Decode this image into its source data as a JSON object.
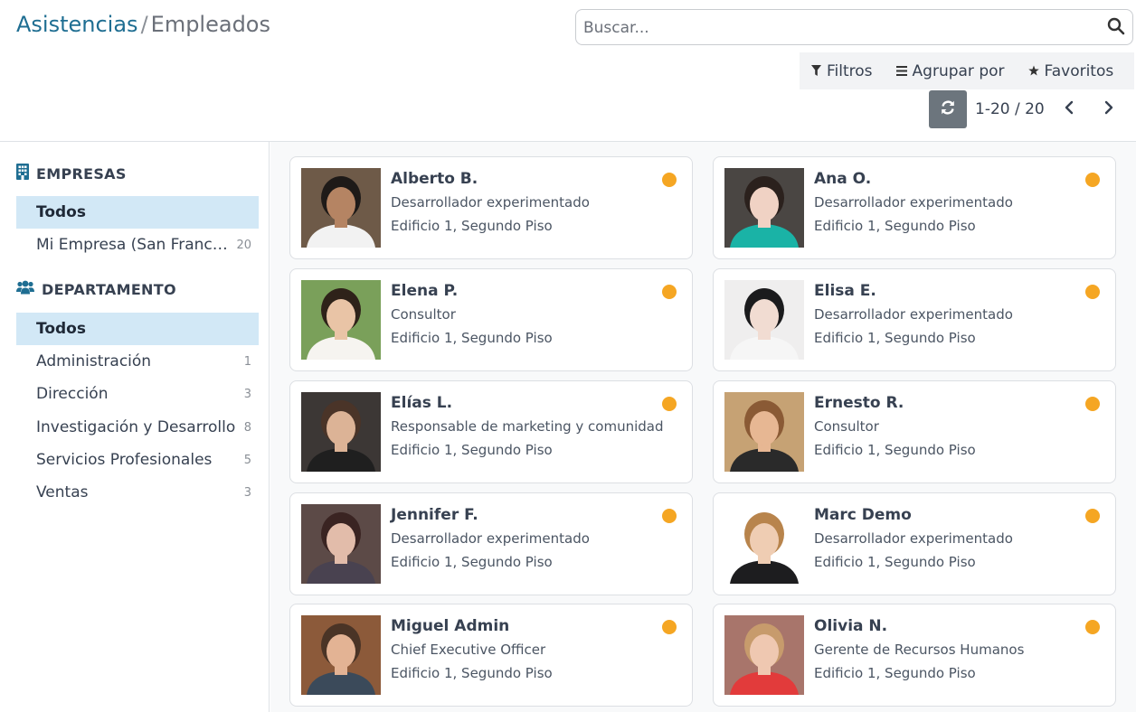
{
  "breadcrumb": {
    "parent": "Asistencias",
    "separator": "/",
    "current": "Empleados"
  },
  "search": {
    "placeholder": "Buscar...",
    "value": ""
  },
  "filters": {
    "filtros": "Filtros",
    "agrupar": "Agrupar por",
    "favoritos": "Favoritos"
  },
  "pager": {
    "value": "1-20 / 20"
  },
  "sidebar": {
    "empresas": {
      "title": "EMPRESAS",
      "items": [
        {
          "label": "Todos",
          "count": "",
          "active": true
        },
        {
          "label": "Mi Empresa (San Francisco)",
          "count": "20",
          "active": false
        }
      ]
    },
    "departamento": {
      "title": "DEPARTAMENTO",
      "items": [
        {
          "label": "Todos",
          "count": "",
          "active": true
        },
        {
          "label": "Administración",
          "count": "1",
          "active": false
        },
        {
          "label": "Dirección",
          "count": "3",
          "active": false
        },
        {
          "label": "Investigación y Desarrollo",
          "count": "8",
          "active": false
        },
        {
          "label": "Servicios Profesionales",
          "count": "5",
          "active": false
        },
        {
          "label": "Ventas",
          "count": "3",
          "active": false
        }
      ]
    }
  },
  "employees": [
    {
      "name": "Alberto B.",
      "job": "Desarrollador experimentado",
      "location": "Edificio 1, Segundo Piso",
      "status_color": "#f5a623",
      "avatar": {
        "bg": "#6e5a48",
        "skin": "#b58463",
        "hair": "#1e1a18",
        "shirt": "#f2f2f2"
      }
    },
    {
      "name": "Ana O.",
      "job": "Desarrollador experimentado",
      "location": "Edificio 1, Segundo Piso",
      "status_color": "#f5a623",
      "avatar": {
        "bg": "#4a4643",
        "skin": "#f0d2c4",
        "hair": "#2b211d",
        "shirt": "#1ab3a6"
      }
    },
    {
      "name": "Elena P.",
      "job": "Consultor",
      "location": "Edificio 1, Segundo Piso",
      "status_color": "#f5a623",
      "avatar": {
        "bg": "#7aa05a",
        "skin": "#e9c4a6",
        "hair": "#2e2219",
        "shirt": "#f6f4f0"
      }
    },
    {
      "name": "Elisa E.",
      "job": "Desarrollador experimentado",
      "location": "Edificio 1, Segundo Piso",
      "status_color": "#f5a623",
      "avatar": {
        "bg": "#efeeee",
        "skin": "#f1dcd2",
        "hair": "#1b1b1d",
        "shirt": "#f6f6f6"
      }
    },
    {
      "name": "Elías L.",
      "job": "Responsable de marketing y comunidad",
      "location": "Edificio 1, Segundo Piso",
      "status_color": "#f5a623",
      "avatar": {
        "bg": "#3c3735",
        "skin": "#dcb396",
        "hair": "#4a3428",
        "shirt": "#1f1f1f"
      }
    },
    {
      "name": "Ernesto R.",
      "job": "Consultor",
      "location": "Edificio 1, Segundo Piso",
      "status_color": "#f5a623",
      "avatar": {
        "bg": "#c6a274",
        "skin": "#e7b793",
        "hair": "#8a5a35",
        "shirt": "#2a2a2a"
      }
    },
    {
      "name": "Jennifer F.",
      "job": "Desarrollador experimentado",
      "location": "Edificio 1, Segundo Piso",
      "status_color": "#f5a623",
      "avatar": {
        "bg": "#5c4a47",
        "skin": "#e2bcaa",
        "hair": "#3a2422",
        "shirt": "#494250"
      }
    },
    {
      "name": "Marc Demo",
      "job": "Desarrollador experimentado",
      "location": "Edificio 1, Segundo Piso",
      "status_color": "#f5a623",
      "avatar": {
        "bg": "#ffffff",
        "skin": "#efcdb3",
        "hair": "#b8844c",
        "shirt": "#1d1d1f"
      }
    },
    {
      "name": "Miguel Admin",
      "job": "Chief Executive Officer",
      "location": "Edificio 1, Segundo Piso",
      "status_color": "#f5a623",
      "avatar": {
        "bg": "#8c5a3a",
        "skin": "#e3b394",
        "hair": "#4a3426",
        "shirt": "#3b4a5a"
      }
    },
    {
      "name": "Olivia N.",
      "job": "Gerente de Recursos Humanos",
      "location": "Edificio 1, Segundo Piso",
      "status_color": "#f5a623",
      "avatar": {
        "bg": "#a8756b",
        "skin": "#efc8b1",
        "hair": "#c79b6c",
        "shirt": "#e23b3b"
      }
    }
  ]
}
